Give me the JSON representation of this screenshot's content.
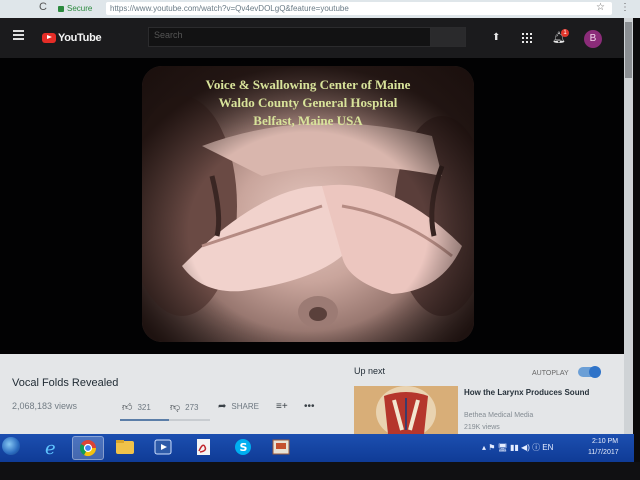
{
  "browser": {
    "reload_glyph": "C",
    "secure_label": "Secure",
    "url": "https://www.youtube.com/watch?v=Qv4evDOLgQ&feature=youtube",
    "star_glyph": "☆",
    "menu_glyph": "⋮"
  },
  "youtube": {
    "logo_text": "YouTube",
    "search_placeholder": "Search",
    "avatar_letter": "B",
    "notification_count": "1"
  },
  "video": {
    "overlay_lines": [
      "Voice & Swallowing Center of Maine",
      "Waldo County General Hospital",
      "Belfast, Maine USA"
    ],
    "title": "Vocal Folds Revealed",
    "views": "2,068,183 views",
    "likes": "321",
    "dislikes": "273",
    "share_label": "SHARE",
    "like_ratio": 0.54
  },
  "sidebar": {
    "up_next_label": "Up next",
    "autoplay_label": "AUTOPLAY",
    "autoplay_on": true,
    "recommendation": {
      "title": "How the Larynx Produces Sound",
      "channel": "Bethea Medical Media",
      "views": "219K views"
    }
  },
  "taskbar": {
    "time": "2:10 PM",
    "date": "11/7/2017"
  },
  "colors": {
    "overlay_text": "#d8e39a",
    "youtube_red": "#e52d27",
    "taskbar": "#1c4fb0"
  }
}
